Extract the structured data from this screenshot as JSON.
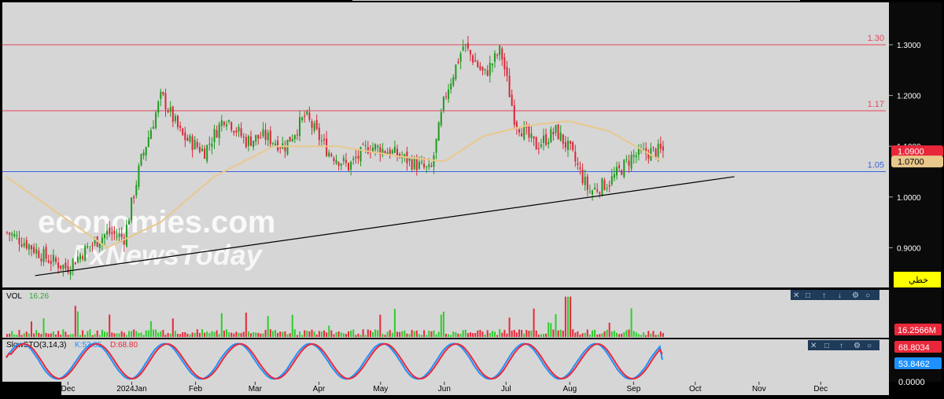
{
  "chart_data": [
    {
      "type": "candlestick",
      "title": "",
      "x_ticks": [
        "Dec",
        "2024Jan",
        "Feb",
        "Mar",
        "Apr",
        "May",
        "Jun",
        "Jul",
        "Aug",
        "Sep",
        "Oct",
        "Nov",
        "Dec"
      ],
      "y_ticks": [
        "1.3000",
        "1.2000",
        "1.1000",
        "1.0000",
        "0.9000"
      ],
      "ylim": [
        0.84,
        1.33
      ],
      "grid": false,
      "levels": [
        {
          "label": "1.30",
          "value": 1.3,
          "color": "#e8475a"
        },
        {
          "label": "1.17",
          "value": 1.17,
          "color": "#e8475a"
        },
        {
          "label": "1.05",
          "value": 1.05,
          "color": "#3b64e0"
        }
      ],
      "trendline": {
        "from": {
          "x": "2023-11-15",
          "y": 0.845
        },
        "to": {
          "x": "2024-10-20",
          "y": 1.04
        }
      },
      "ma_color": "#e9c88c",
      "price_tags": [
        {
          "label": "1.0900",
          "value": 1.09,
          "bg": "#e8283a",
          "fg": "#ffffff"
        },
        {
          "label": "1.0700",
          "value": 1.07,
          "bg": "#e9c88c",
          "fg": "#000000"
        }
      ],
      "mode_label": "خطي",
      "series": {
        "anchors_date": [
          "2023-11-01",
          "2023-11-10",
          "2023-11-20",
          "2023-11-30",
          "2023-12-10",
          "2023-12-20",
          "2023-12-28",
          "2024-01-05",
          "2024-01-15",
          "2024-01-25",
          "2024-02-05",
          "2024-02-15",
          "2024-02-25",
          "2024-03-05",
          "2024-03-15",
          "2024-03-25",
          "2024-04-05",
          "2024-04-15",
          "2024-04-25",
          "2024-05-05",
          "2024-05-15",
          "2024-05-25",
          "2024-06-01",
          "2024-06-10",
          "2024-06-20",
          "2024-06-28",
          "2024-07-05",
          "2024-07-15",
          "2024-07-25",
          "2024-08-01",
          "2024-08-10",
          "2024-08-20",
          "2024-08-31",
          "2024-09-10",
          "2024-09-15"
        ],
        "anchors_close": [
          0.93,
          0.91,
          0.88,
          0.86,
          0.9,
          0.93,
          0.92,
          1.07,
          1.2,
          1.12,
          1.09,
          1.16,
          1.11,
          1.12,
          1.1,
          1.16,
          1.09,
          1.06,
          1.1,
          1.09,
          1.07,
          1.05,
          1.2,
          1.3,
          1.24,
          1.29,
          1.15,
          1.1,
          1.13,
          1.09,
          1.01,
          1.03,
          1.08,
          1.09,
          1.09
        ],
        "ma_anchors_date": [
          "2023-11-01",
          "2023-12-20",
          "2024-01-15",
          "2024-02-10",
          "2024-03-10",
          "2024-04-10",
          "2024-05-10",
          "2024-06-01",
          "2024-06-20",
          "2024-07-10",
          "2024-07-31",
          "2024-08-20",
          "2024-09-15"
        ],
        "ma_anchors_value": [
          1.04,
          0.9,
          0.95,
          1.04,
          1.1,
          1.1,
          1.08,
          1.07,
          1.12,
          1.14,
          1.15,
          1.13,
          1.07
        ]
      }
    },
    {
      "type": "bar",
      "title": "VOL",
      "value_label": "16.26",
      "y_tick": "16.2566M",
      "scale_max": 75
    },
    {
      "type": "line",
      "title": "SlowSTO(3,14,3)",
      "k_label": "K:53.85",
      "d_label": "D:68.80",
      "ylim": [
        0,
        100
      ],
      "series": [
        {
          "name": "K",
          "color": "#1e90ff",
          "last": 53.85
        },
        {
          "name": "D",
          "color": "#e8283a",
          "last": 68.8
        }
      ],
      "y_ticks": [
        "68.8034",
        "53.8462",
        "0.0000"
      ]
    }
  ],
  "watermark": {
    "line1": "economies.com",
    "line2": "FxNewsToday"
  }
}
